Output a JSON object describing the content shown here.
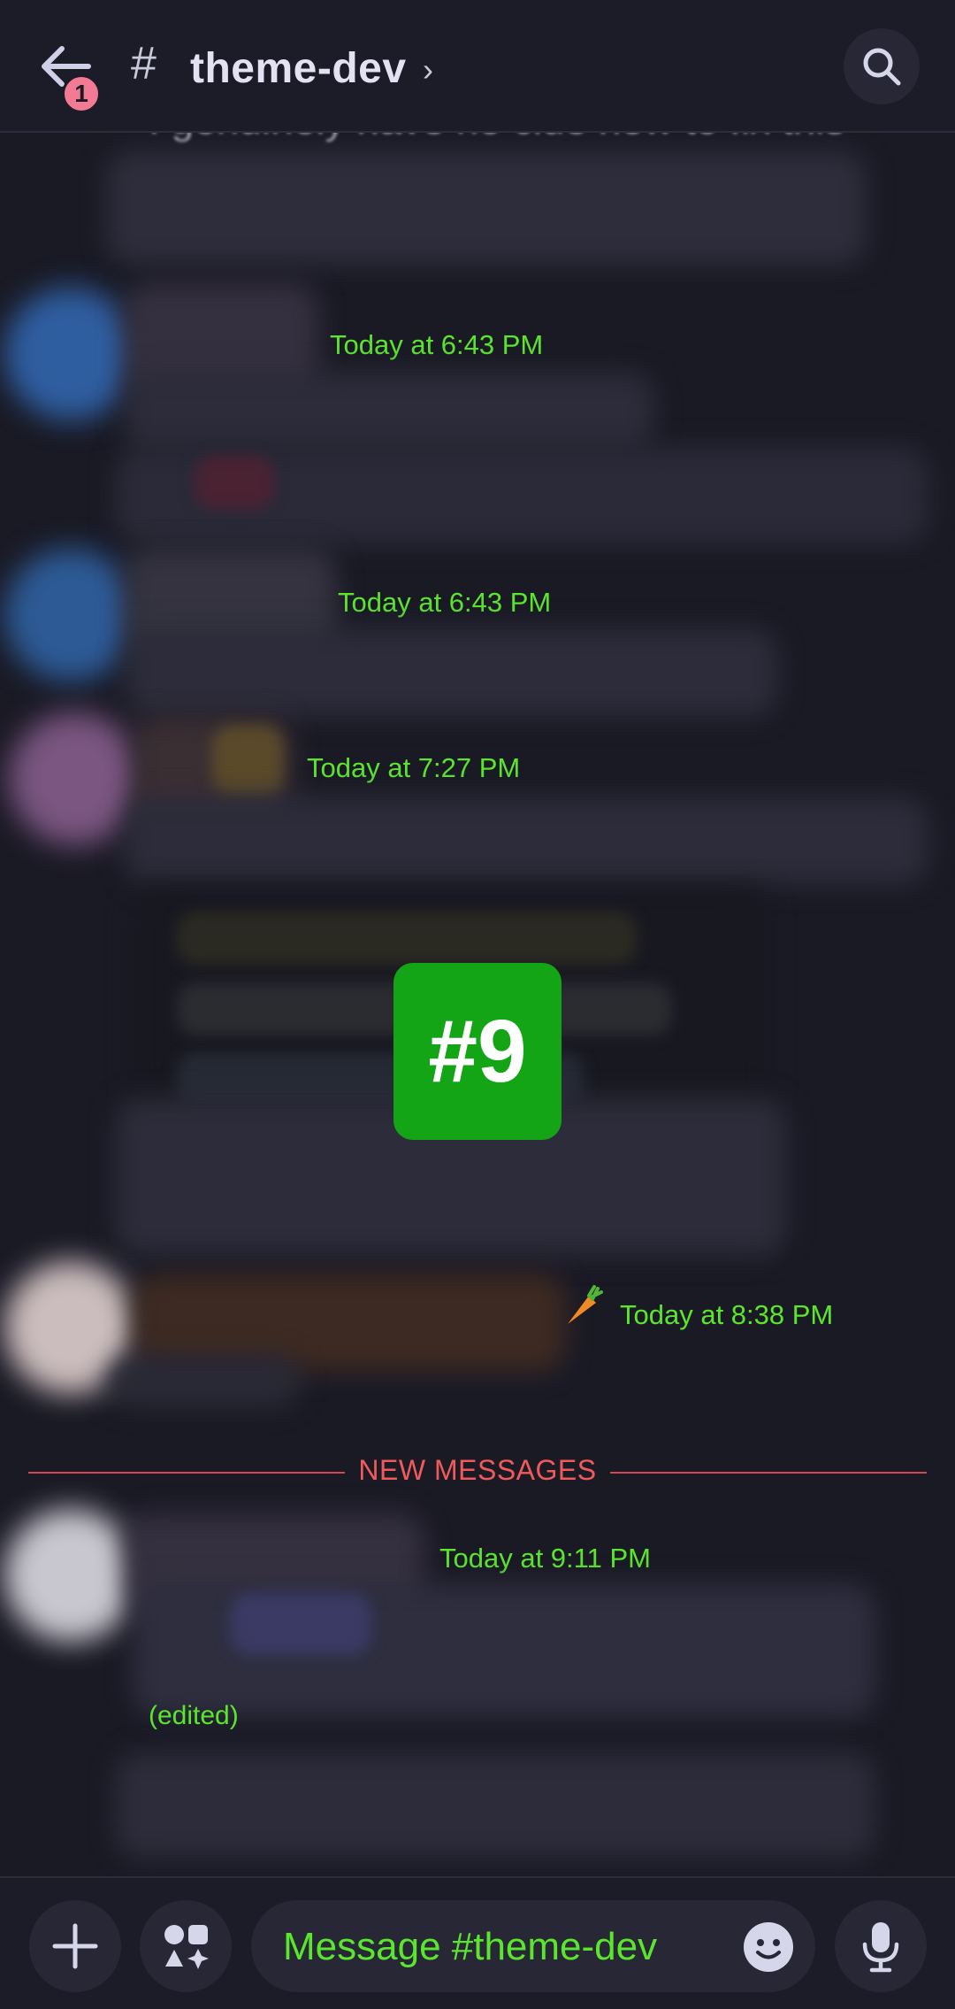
{
  "header": {
    "back_icon": "arrow-left-icon",
    "badge_count": "1",
    "channel_hash": "#",
    "channel_name": "theme-dev",
    "chevron": "›",
    "search_icon": "search-icon"
  },
  "messages": {
    "top_ghost_text": "I genuinely have no clue how to fix this",
    "timestamps": [
      "Today at 6:43 PM",
      "Today at 6:43 PM",
      "Today at 7:27 PM",
      "Today at 8:38 PM",
      "Today at 9:11 PM"
    ],
    "center_badge": "#9",
    "new_messages_label": "NEW MESSAGES",
    "edited_label": "(edited)"
  },
  "composer": {
    "placeholder": "Message #theme-dev",
    "plus_icon": "plus-icon",
    "apps_icon": "apps-icon",
    "emoji_icon": "emoji-icon",
    "mic_icon": "microphone-icon"
  },
  "colors": {
    "background": "#1a1a25",
    "accent_green": "#5be62e",
    "badge_green": "#13a515",
    "new_messages_red": "#ef5b5b",
    "notification_pink": "#f27a94"
  }
}
